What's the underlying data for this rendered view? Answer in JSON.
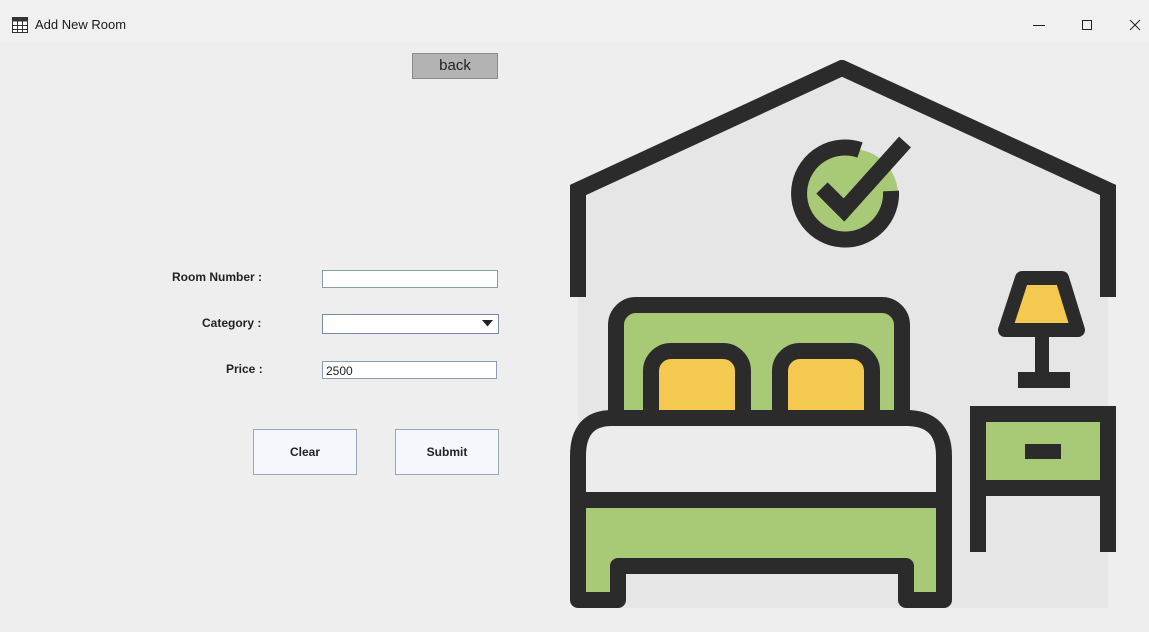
{
  "window": {
    "title": "Add New Room"
  },
  "form": {
    "back_label": "back",
    "room_number_label": "Room Number :",
    "room_number_value": "",
    "category_label": "Category :",
    "category_value": "",
    "price_label": "Price :",
    "price_value": "2500",
    "clear_label": "Clear",
    "submit_label": "Submit"
  },
  "icons": {
    "app": "calendar-grid-icon",
    "minimize": "minimize-icon",
    "maximize": "maximize-icon",
    "close": "close-icon",
    "dropdown": "chevron-down-icon",
    "illustration": "bedroom-with-checkmark-illustration"
  },
  "colors": {
    "outline": "#2b2b2b",
    "green": "#a8c976",
    "yellow": "#f4c94f",
    "wall": "#e6e6e6"
  }
}
